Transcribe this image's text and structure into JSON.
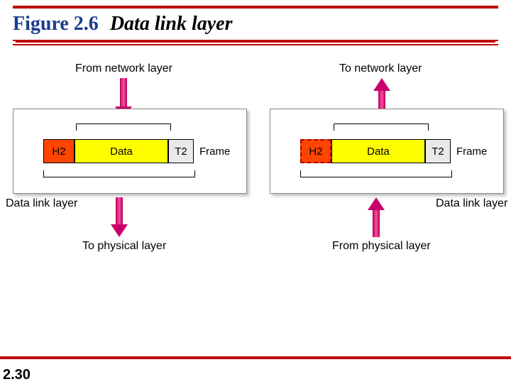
{
  "figure": {
    "number": "Figure 2.6",
    "title": "Data link layer"
  },
  "labels": {
    "from_network": "From network layer",
    "to_network": "To network layer",
    "to_physical": "To physical layer",
    "from_physical": "From physical layer",
    "data_link_left": "Data link layer",
    "data_link_right": "Data link layer",
    "frame": "Frame"
  },
  "segments": {
    "h2": "H2",
    "data": "Data",
    "t2": "T2"
  },
  "page": "2.30"
}
